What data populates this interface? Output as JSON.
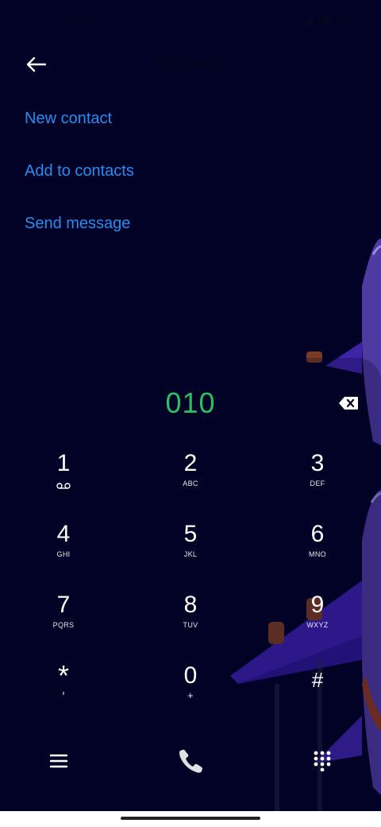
{
  "status_bar": {
    "time": "7:05 AM",
    "battery": "100"
  },
  "header": {
    "title": "Recents"
  },
  "actions": [
    {
      "label": "New contact"
    },
    {
      "label": "Add to contacts"
    },
    {
      "label": "Send message"
    }
  ],
  "dialer": {
    "number": "010",
    "keys": [
      {
        "digit": "1",
        "letters": ""
      },
      {
        "digit": "2",
        "letters": "ABC"
      },
      {
        "digit": "3",
        "letters": "DEF"
      },
      {
        "digit": "4",
        "letters": "GHI"
      },
      {
        "digit": "5",
        "letters": "JKL"
      },
      {
        "digit": "6",
        "letters": "MNO"
      },
      {
        "digit": "7",
        "letters": "PQRS"
      },
      {
        "digit": "8",
        "letters": "TUV"
      },
      {
        "digit": "9",
        "letters": "WXYZ"
      },
      {
        "digit": "*",
        "letters": ","
      },
      {
        "digit": "0",
        "letters": "+"
      },
      {
        "digit": "#",
        "letters": ""
      }
    ]
  },
  "icons": {
    "back": "arrow-left-icon",
    "backspace": "backspace-icon",
    "voicemail": "voicemail-icon",
    "menu": "menu-icon",
    "call": "phone-icon",
    "keypad": "dialpad-icon"
  },
  "colors": {
    "background": "#020226",
    "accent_link": "#2a8cf2",
    "number": "#2cc063",
    "call_button": "#e0e0e0"
  }
}
